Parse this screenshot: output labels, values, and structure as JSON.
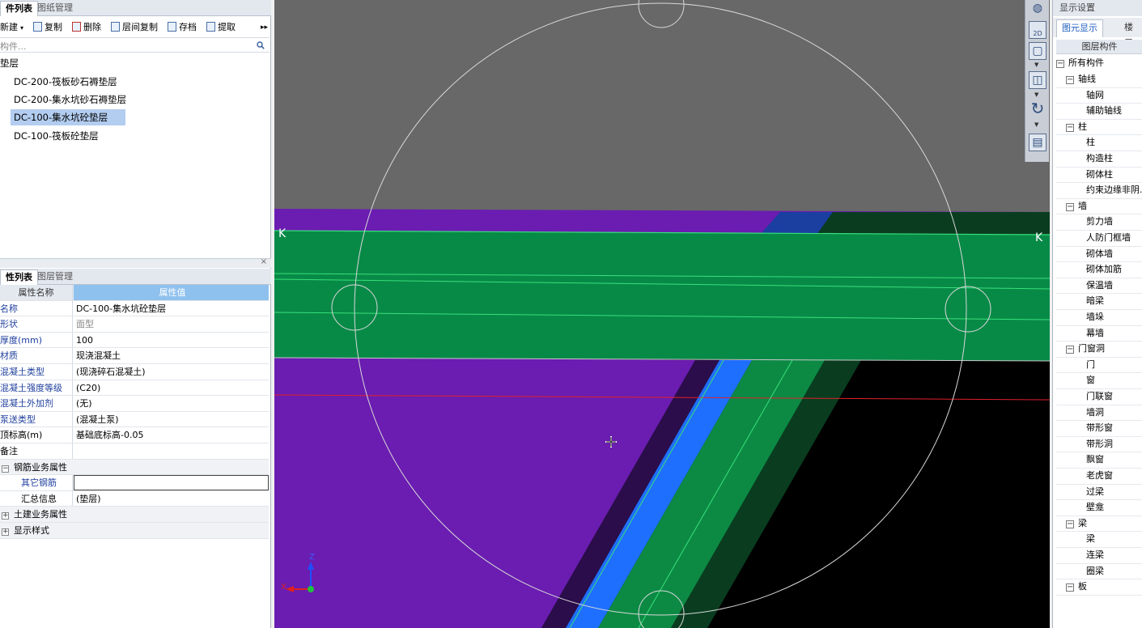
{
  "left_top": {
    "tabs": [
      "件列表",
      "图纸管理"
    ],
    "toolbar": {
      "new": "新建",
      "copy": "复制",
      "delete": "删除",
      "floor_copy": "层间复制",
      "save": "存档",
      "extract": "提取"
    },
    "search_placeholder": "构件...",
    "group": "垫层",
    "items": [
      "DC-200-筏板砂石褥垫层",
      "DC-200-集水坑砂石褥垫层",
      "DC-100-集水坑砼垫层",
      "DC-100-筏板砼垫层"
    ]
  },
  "left_bottom": {
    "tabs": [
      "性列表",
      "图层管理"
    ],
    "header": {
      "name": "属性名称",
      "value": "属性值"
    },
    "rows": [
      {
        "name": "名称",
        "value": "DC-100-集水坑砼垫层"
      },
      {
        "name": "形状",
        "value": "面型"
      },
      {
        "name": "厚度(mm)",
        "value": "100"
      },
      {
        "name": "材质",
        "value": "现浇混凝土"
      },
      {
        "name": "混凝土类型",
        "value": "(现浇碎石混凝土)"
      },
      {
        "name": "混凝土强度等级",
        "value": "(C20)"
      },
      {
        "name": "混凝土外加剂",
        "value": "(无)"
      },
      {
        "name": "泵送类型",
        "value": "(混凝土泵)"
      },
      {
        "name": "顶标高(m)",
        "value": "基础底标高-0.05"
      },
      {
        "name": "备注",
        "value": ""
      },
      {
        "name": "钢筋业务属性",
        "value": ""
      },
      {
        "name": "其它钢筋",
        "value": ""
      },
      {
        "name": "汇总信息",
        "value": "(垫层)"
      },
      {
        "name": "土建业务属性",
        "value": ""
      },
      {
        "name": "显示样式",
        "value": ""
      }
    ]
  },
  "viewport": {
    "axis_left": "K",
    "axis_right": "K",
    "triad": {
      "x": "X",
      "z": "Z"
    }
  },
  "vtools": {
    "mode_2d": "2D"
  },
  "right_panel": {
    "title": "显示设置",
    "tabs": [
      "图元显示",
      "楼层"
    ],
    "column_header": "图层构件",
    "root": "所有构件",
    "tree": [
      {
        "label": "轴线",
        "level": 1
      },
      {
        "label": "轴网",
        "level": 2
      },
      {
        "label": "辅助轴线",
        "level": 2
      },
      {
        "label": "柱",
        "level": 1
      },
      {
        "label": "柱",
        "level": 2
      },
      {
        "label": "构造柱",
        "level": 2
      },
      {
        "label": "砌体柱",
        "level": 2
      },
      {
        "label": "约束边缘非阴...",
        "level": 2
      },
      {
        "label": "墙",
        "level": 1
      },
      {
        "label": "剪力墙",
        "level": 2
      },
      {
        "label": "人防门框墙",
        "level": 2
      },
      {
        "label": "砌体墙",
        "level": 2
      },
      {
        "label": "砌体加筋",
        "level": 2
      },
      {
        "label": "保温墙",
        "level": 2
      },
      {
        "label": "暗梁",
        "level": 2
      },
      {
        "label": "墙垛",
        "level": 2
      },
      {
        "label": "幕墙",
        "level": 2
      },
      {
        "label": "门窗洞",
        "level": 1
      },
      {
        "label": "门",
        "level": 2
      },
      {
        "label": "窗",
        "level": 2
      },
      {
        "label": "门联窗",
        "level": 2
      },
      {
        "label": "墙洞",
        "level": 2
      },
      {
        "label": "带形窗",
        "level": 2
      },
      {
        "label": "带形洞",
        "level": 2
      },
      {
        "label": "飘窗",
        "level": 2
      },
      {
        "label": "老虎窗",
        "level": 2
      },
      {
        "label": "过梁",
        "level": 2
      },
      {
        "label": "壁龛",
        "level": 2
      },
      {
        "label": "梁",
        "level": 1
      },
      {
        "label": "梁",
        "level": 2
      },
      {
        "label": "连梁",
        "level": 2
      },
      {
        "label": "圈梁",
        "level": 2
      },
      {
        "label": "板",
        "level": 1
      }
    ]
  }
}
